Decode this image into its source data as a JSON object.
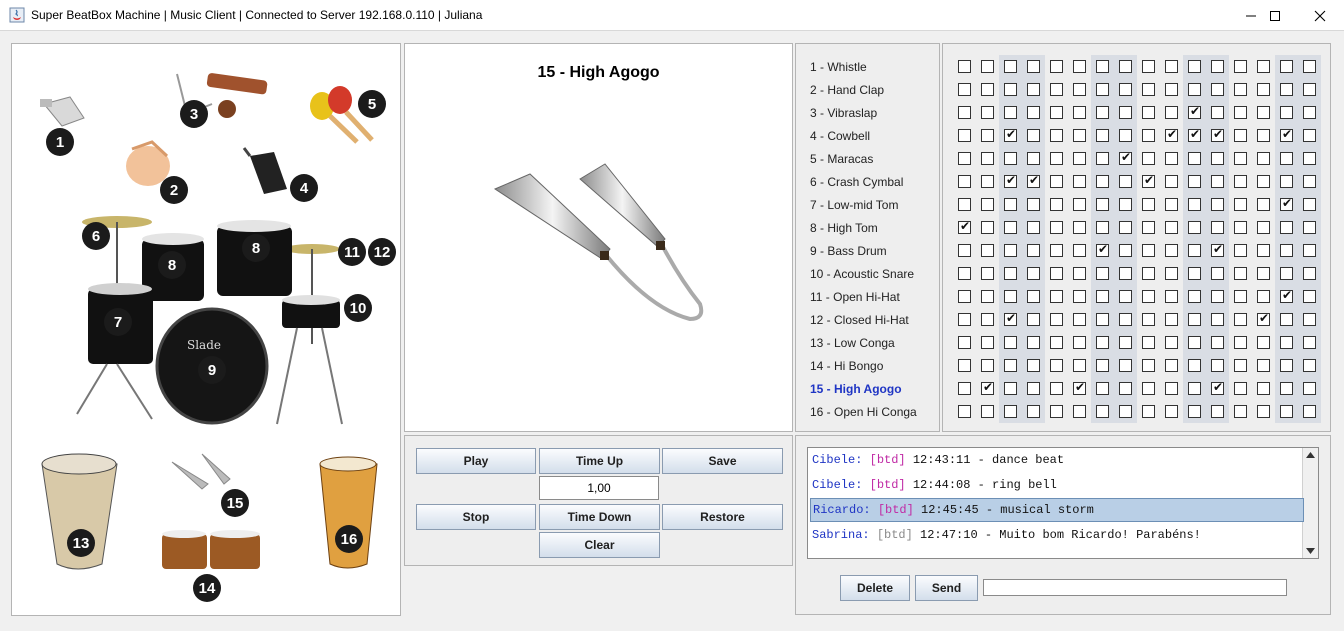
{
  "window": {
    "title": "Super BeatBox Machine | Music Client | Connected to Server 192.168.0.110 | Juliana"
  },
  "instruments": [
    "1 - Whistle",
    "2 - Hand Clap",
    "3 - Vibraslap",
    "4 - Cowbell",
    "5 - Maracas",
    "6 - Crash Cymbal",
    "7 - Low-mid Tom",
    "8 - High Tom",
    "9 - Bass Drum",
    "10 - Acoustic Snare",
    "11 - Open Hi-Hat",
    "12 - Closed Hi-Hat",
    "13 - Low Conga",
    "14 - Hi Bongo",
    "15 - High Agogo",
    "16 - Open Hi Conga"
  ],
  "selected_instrument_index": 14,
  "preview": {
    "title": "15 - High Agogo"
  },
  "image_labels": [
    "1",
    "2",
    "3",
    "4",
    "5",
    "6",
    "7",
    "8",
    "8",
    "9",
    "10",
    "11",
    "12",
    "13",
    "14",
    "15",
    "16"
  ],
  "grid": {
    "rows": 16,
    "cols": 16,
    "checked": [
      [],
      [],
      [
        10
      ],
      [
        2,
        9,
        10,
        11,
        14
      ],
      [
        7
      ],
      [
        2,
        3,
        8
      ],
      [
        14
      ],
      [
        0
      ],
      [
        6,
        11
      ],
      [],
      [
        14
      ],
      [
        2,
        13
      ],
      [],
      [],
      [
        1,
        5,
        11
      ],
      []
    ]
  },
  "controls": {
    "play": "Play",
    "time_up": "Time Up",
    "save": "Save",
    "tempo": "1,00",
    "stop": "Stop",
    "time_down": "Time Down",
    "restore": "Restore",
    "clear": "Clear"
  },
  "chat": {
    "messages": [
      {
        "name": "Cibele:",
        "tag": "[btd]",
        "text": "12:43:11 - dance beat",
        "tag_style": "magenta"
      },
      {
        "name": "Cibele:",
        "tag": "[btd]",
        "text": "12:44:08 - ring bell",
        "tag_style": "magenta"
      },
      {
        "name": "Ricardo:",
        "tag": "[btd]",
        "text": "12:45:45 - musical storm",
        "tag_style": "magenta"
      },
      {
        "name": "Sabrina:",
        "tag": "[btd]",
        "text": "12:47:10 - Muito bom Ricardo! Parabéns!",
        "tag_style": "grey"
      }
    ],
    "selected_index": 2,
    "delete": "Delete",
    "send": "Send",
    "input_value": ""
  },
  "colors": {
    "accent": "#1f35c4",
    "tag": "#c02aa5",
    "selection": "#b9cfe6",
    "grid_shade": "#d9dde4"
  }
}
